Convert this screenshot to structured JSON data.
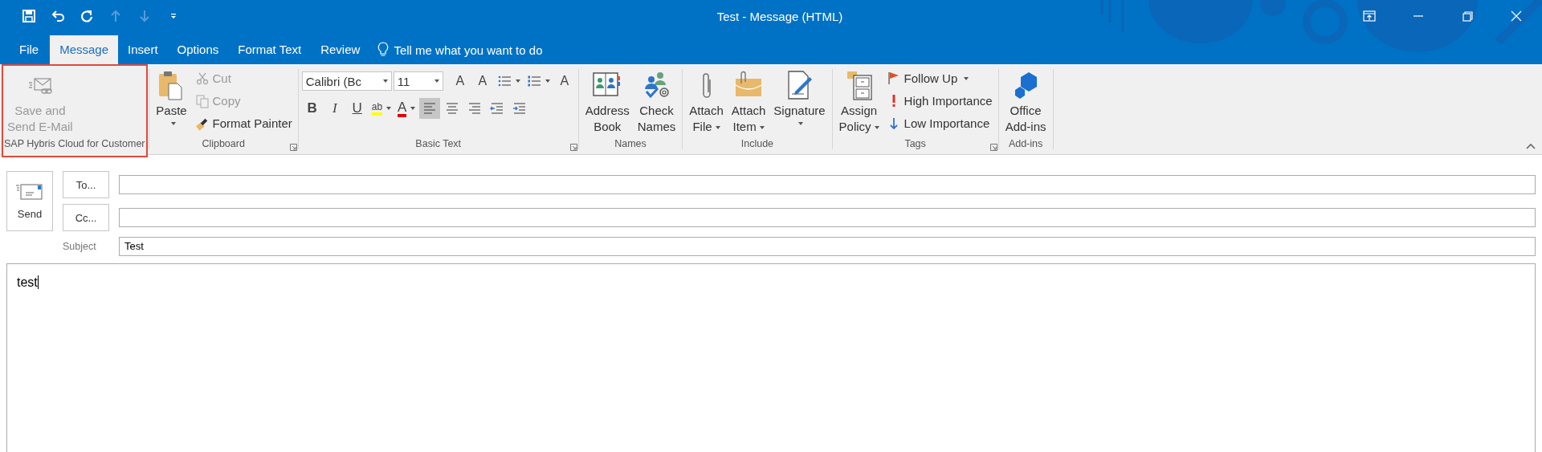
{
  "window": {
    "title": "Test - Message (HTML)"
  },
  "quick_access": [
    {
      "kind": "save",
      "disabled": false
    },
    {
      "kind": "undo",
      "disabled": false
    },
    {
      "kind": "redo",
      "disabled": false
    },
    {
      "kind": "up",
      "disabled": true
    },
    {
      "kind": "down",
      "disabled": true
    },
    {
      "kind": "customize",
      "disabled": false
    }
  ],
  "window_controls": [
    {
      "kind": "ribbon_options"
    },
    {
      "kind": "minimize"
    },
    {
      "kind": "restore"
    },
    {
      "kind": "close"
    }
  ],
  "tabs": [
    {
      "label": "File",
      "selected": false
    },
    {
      "label": "Message",
      "selected": true
    },
    {
      "label": "Insert",
      "selected": false
    },
    {
      "label": "Options",
      "selected": false
    },
    {
      "label": "Format Text",
      "selected": false
    },
    {
      "label": "Review",
      "selected": false
    }
  ],
  "tell_me": {
    "placeholder": "Tell me what you want to do"
  },
  "ribbon": {
    "groups": [
      {
        "kind": "sap",
        "label": "SAP Hybris Cloud for Customer",
        "highlighted": true,
        "large": [
          {
            "kind": "mail_link",
            "lines": [
              "Save and",
              "Send E-Mail"
            ],
            "disabled": true
          }
        ]
      },
      {
        "kind": "clipboard",
        "label": "Clipboard",
        "launcher": true,
        "large": [
          {
            "kind": "paste",
            "lines": [
              "Paste"
            ],
            "dropdown": true,
            "disabled": false
          }
        ],
        "small": [
          {
            "kind": "cut",
            "label": "Cut",
            "disabled": true
          },
          {
            "kind": "copy",
            "label": "Copy",
            "disabled": true
          },
          {
            "kind": "brush",
            "label": "Format Painter",
            "disabled": false
          }
        ]
      },
      {
        "kind": "basic_text",
        "label": "Basic Text",
        "launcher": true,
        "font_name": "Calibri (Bc",
        "font_size": "11",
        "row1": [
          {
            "kind": "grow",
            "glyph": "A",
            "selected": false
          },
          {
            "kind": "shrink",
            "glyph": "A",
            "selected": false
          },
          {
            "kind": "bullets",
            "dropdown": true,
            "selected": false
          },
          {
            "kind": "numbering",
            "dropdown": true,
            "selected": false
          },
          {
            "kind": "clear",
            "glyph": "A",
            "selected": false
          }
        ],
        "row2": [
          {
            "kind": "bold",
            "glyph": "B",
            "selected": false
          },
          {
            "kind": "italic",
            "glyph": "I",
            "selected": false
          },
          {
            "kind": "underline",
            "glyph": "U",
            "selected": false
          },
          {
            "kind": "highlight",
            "glyph": "ab",
            "dropdown": true,
            "selected": false
          },
          {
            "kind": "font_color",
            "glyph": "A",
            "dropdown": true,
            "selected": false
          },
          {
            "kind": "align_left",
            "selected": true
          },
          {
            "kind": "align_center",
            "selected": false
          },
          {
            "kind": "align_right",
            "selected": false
          },
          {
            "kind": "outdent",
            "selected": false
          },
          {
            "kind": "indent",
            "selected": false
          }
        ]
      },
      {
        "kind": "names",
        "label": "Names",
        "large": [
          {
            "kind": "address_book",
            "lines": [
              "Address",
              "Book"
            ],
            "disabled": false
          },
          {
            "kind": "check_names",
            "lines": [
              "Check",
              "Names"
            ],
            "disabled": false
          }
        ]
      },
      {
        "kind": "include",
        "label": "Include",
        "large": [
          {
            "kind": "clip",
            "lines": [
              "Attach",
              "File"
            ],
            "dropdown": true,
            "disabled": false
          },
          {
            "kind": "envelope_clip",
            "lines": [
              "Attach",
              "Item"
            ],
            "dropdown": true,
            "disabled": false
          },
          {
            "kind": "signature",
            "lines": [
              "Signature"
            ],
            "dropdown": true,
            "disabled": false
          }
        ]
      },
      {
        "kind": "tags",
        "label": "Tags",
        "launcher": true,
        "large": [
          {
            "kind": "cabinet",
            "lines": [
              "Assign",
              "Policy"
            ],
            "dropdown": true,
            "disabled": false
          }
        ],
        "small": [
          {
            "kind": "flag",
            "label": "Follow Up",
            "disabled": false,
            "dropdown": true
          },
          {
            "kind": "exclaim",
            "label": "High Importance",
            "disabled": false
          },
          {
            "kind": "down_arrow",
            "label": "Low Importance",
            "disabled": false
          }
        ]
      },
      {
        "kind": "addins",
        "label": "Add-ins",
        "large": [
          {
            "kind": "hexagons",
            "lines": [
              "Office",
              "Add-ins"
            ],
            "disabled": false
          }
        ]
      }
    ]
  },
  "compose": {
    "send": "Send",
    "to_button": "To...",
    "cc_button": "Cc...",
    "subject_label": "Subject",
    "subject": "Test",
    "body": "test"
  }
}
